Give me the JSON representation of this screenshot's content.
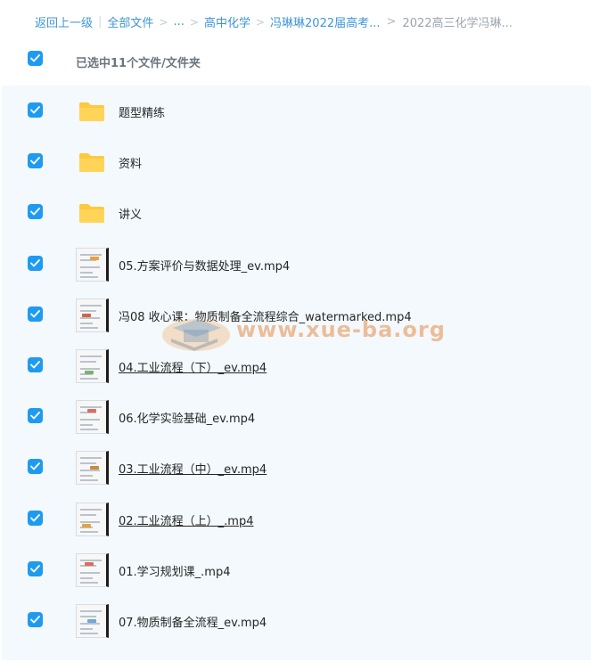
{
  "breadcrumb": {
    "back": "返回上一级",
    "all_files": "全部文件",
    "ellipsis": "...",
    "level1": "高中化学",
    "level2": "冯琳琳2022届高考...",
    "current": "2022高三化学冯琳..."
  },
  "header": {
    "selected_text": "已选中11个文件/文件夹"
  },
  "colors": {
    "checkbox": "#1e9bf0",
    "link": "#3d95d8",
    "folder": "#ffc93d",
    "list_background": "#f3f9fd"
  },
  "watermark": {
    "text": "www.xue-ba.org"
  },
  "files": [
    {
      "name": "题型精练",
      "type": "folder",
      "icon": "folder-icon"
    },
    {
      "name": "资料",
      "type": "folder",
      "icon": "folder-icon"
    },
    {
      "name": "讲义",
      "type": "folder",
      "icon": "folder-icon"
    },
    {
      "name": "05.方案评价与数据处理_ev.mp4",
      "type": "video",
      "icon": "video-thumbnail"
    },
    {
      "name": "冯08 收心课：物质制备全流程综合_watermarked.mp4",
      "type": "video",
      "icon": "video-thumbnail"
    },
    {
      "name": "04.工业流程（下）_ev.mp4",
      "type": "video",
      "icon": "video-thumbnail"
    },
    {
      "name": "06.化学实验基础_ev.mp4",
      "type": "video",
      "icon": "video-thumbnail"
    },
    {
      "name": "03.工业流程（中）_ev.mp4",
      "type": "video",
      "icon": "video-thumbnail"
    },
    {
      "name": "02.工业流程（上）_.mp4",
      "type": "video",
      "icon": "video-thumbnail"
    },
    {
      "name": "01.学习规划课_.mp4",
      "type": "video",
      "icon": "video-thumbnail"
    },
    {
      "name": "07.物质制备全流程_ev.mp4",
      "type": "video",
      "icon": "video-thumbnail"
    }
  ]
}
